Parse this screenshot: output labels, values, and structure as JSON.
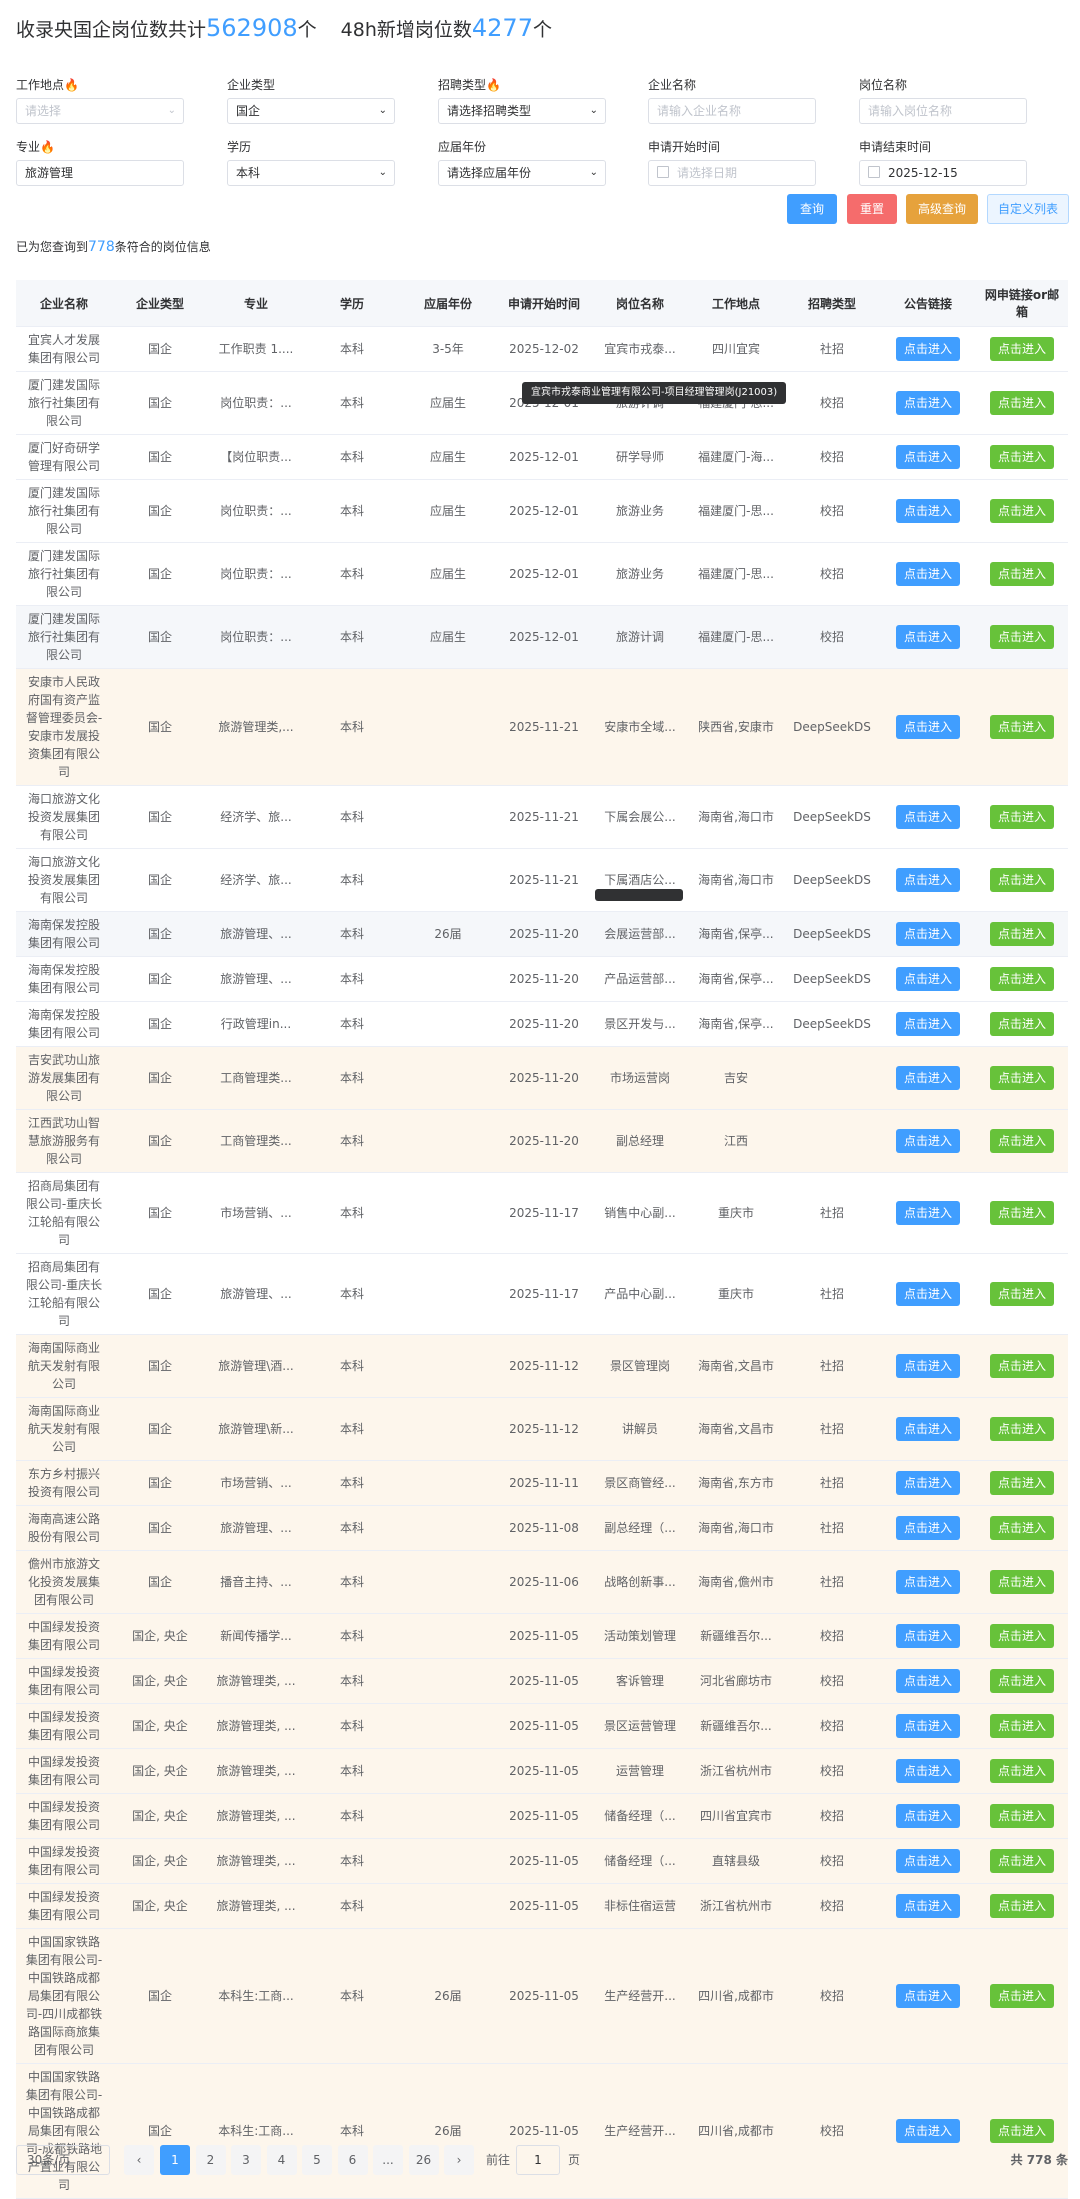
{
  "header": {
    "prefix": "收录央国企岗位数共计",
    "total_count": "562908",
    "unit1": "个",
    "new_label": "48h新增岗位数",
    "new_count": "4277",
    "unit2": "个"
  },
  "filters": {
    "work_location": {
      "label": "工作地点",
      "placeholder": "请选择"
    },
    "company_type": {
      "label": "企业类型",
      "value": "国企"
    },
    "recruit_type": {
      "label": "招聘类型",
      "value": "请选择招聘类型"
    },
    "company_name": {
      "label": "企业名称",
      "placeholder": "请输入企业名称"
    },
    "job_name": {
      "label": "岗位名称",
      "placeholder": "请输入岗位名称"
    },
    "major": {
      "label": "专业",
      "value": "旅游管理"
    },
    "education": {
      "label": "学历",
      "value": "本科"
    },
    "grad_year": {
      "label": "应届年份",
      "value": "请选择应届年份"
    },
    "start_date": {
      "label": "申请开始时间",
      "placeholder": "请选择日期"
    },
    "end_date": {
      "label": "申请结束时间",
      "value": "2025-12-15"
    },
    "fire_icon": "🔥"
  },
  "buttons": {
    "query": "查询",
    "reset": "重置",
    "advanced": "高级查询",
    "custom_list": "自定义列表"
  },
  "result": {
    "prefix": "已为您查询到",
    "count": "778",
    "suffix": "条符合的岗位信息"
  },
  "table": {
    "columns": [
      "企业名称",
      "企业类型",
      "专业",
      "学历",
      "应届年份",
      "申请开始时间",
      "岗位名称",
      "工作地点",
      "招聘类型",
      "公告链接",
      "网申链接or邮箱"
    ],
    "link_label": "点击进入",
    "rows": [
      {
        "company": "宜宾人才发展集团有限公司",
        "type": "国企",
        "major": "工作职责 1....",
        "edu": "本科",
        "year": "3-5年",
        "date": "2025-12-02",
        "job": "宜宾市戎泰...",
        "loc": "四川宜宾",
        "recruit": "社招",
        "bg": "w"
      },
      {
        "company": "厦门建发国际旅行社集团有限公司",
        "type": "国企",
        "major": "岗位职责：...",
        "edu": "本科",
        "year": "应届生",
        "date": "2025-12-01",
        "job": "旅游计调",
        "loc": "福建厦门-思...",
        "recruit": "校招",
        "bg": "w"
      },
      {
        "company": "厦门好奇研学管理有限公司",
        "type": "国企",
        "major": "【岗位职责...",
        "edu": "本科",
        "year": "应届生",
        "date": "2025-12-01",
        "job": "研学导师",
        "loc": "福建厦门-海...",
        "recruit": "校招",
        "bg": "w"
      },
      {
        "company": "厦门建发国际旅行社集团有限公司",
        "type": "国企",
        "major": "岗位职责：...",
        "edu": "本科",
        "year": "应届生",
        "date": "2025-12-01",
        "job": "旅游业务",
        "loc": "福建厦门-思...",
        "recruit": "校招",
        "bg": "w"
      },
      {
        "company": "厦门建发国际旅行社集团有限公司",
        "type": "国企",
        "major": "岗位职责：...",
        "edu": "本科",
        "year": "应届生",
        "date": "2025-12-01",
        "job": "旅游业务",
        "loc": "福建厦门-思...",
        "recruit": "校招",
        "bg": "w"
      },
      {
        "company": "厦门建发国际旅行社集团有限公司",
        "type": "国企",
        "major": "岗位职责：...",
        "edu": "本科",
        "year": "应届生",
        "date": "2025-12-01",
        "job": "旅游计调",
        "loc": "福建厦门-思...",
        "recruit": "校招",
        "bg": "g"
      },
      {
        "company": "安康市人民政府国有资产监督管理委员会-安康市发展投资集团有限公司",
        "type": "国企",
        "major": "旅游管理类,...",
        "edu": "本科",
        "year": "",
        "date": "2025-11-21",
        "job": "安康市全域...",
        "loc": "陕西省,安康市",
        "recruit": "DeepSeekDS",
        "bg": "o"
      },
      {
        "company": "海口旅游文化投资发展集团有限公司",
        "type": "国企",
        "major": "经济学、旅...",
        "edu": "本科",
        "year": "",
        "date": "2025-11-21",
        "job": "下属会展公...",
        "loc": "海南省,海口市",
        "recruit": "DeepSeekDS",
        "bg": "w"
      },
      {
        "company": "海口旅游文化投资发展集团有限公司",
        "type": "国企",
        "major": "经济学、旅...",
        "edu": "本科",
        "year": "",
        "date": "2025-11-21",
        "job": "下属酒店公...",
        "loc": "海南省,海口市",
        "recruit": "DeepSeekDS",
        "bg": "w"
      },
      {
        "company": "海南保发控股集团有限公司",
        "type": "国企",
        "major": "旅游管理、...",
        "edu": "本科",
        "year": "26届",
        "date": "2025-11-20",
        "job": "会展运营部...",
        "loc": "海南省,保亭...",
        "recruit": "DeepSeekDS",
        "bg": "g"
      },
      {
        "company": "海南保发控股集团有限公司",
        "type": "国企",
        "major": "旅游管理、...",
        "edu": "本科",
        "year": "",
        "date": "2025-11-20",
        "job": "产品运营部...",
        "loc": "海南省,保亭...",
        "recruit": "DeepSeekDS",
        "bg": "w"
      },
      {
        "company": "海南保发控股集团有限公司",
        "type": "国企",
        "major": "行政管理in...",
        "edu": "本科",
        "year": "",
        "date": "2025-11-20",
        "job": "景区开发与...",
        "loc": "海南省,保亭...",
        "recruit": "DeepSeekDS",
        "bg": "w"
      },
      {
        "company": "吉安武功山旅游发展集团有限公司",
        "type": "国企",
        "major": "工商管理类...",
        "edu": "本科",
        "year": "",
        "date": "2025-11-20",
        "job": "市场运营岗",
        "loc": "吉安",
        "recruit": "",
        "bg": "o"
      },
      {
        "company": "江西武功山智慧旅游服务有限公司",
        "type": "国企",
        "major": "工商管理类...",
        "edu": "本科",
        "year": "",
        "date": "2025-11-20",
        "job": "副总经理",
        "loc": "江西",
        "recruit": "",
        "bg": "o"
      },
      {
        "company": "招商局集团有限公司-重庆长江轮船有限公司",
        "type": "国企",
        "major": "市场营销、...",
        "edu": "本科",
        "year": "",
        "date": "2025-11-17",
        "job": "销售中心副...",
        "loc": "重庆市",
        "recruit": "社招",
        "bg": "w"
      },
      {
        "company": "招商局集团有限公司-重庆长江轮船有限公司",
        "type": "国企",
        "major": "旅游管理、...",
        "edu": "本科",
        "year": "",
        "date": "2025-11-17",
        "job": "产品中心副...",
        "loc": "重庆市",
        "recruit": "社招",
        "bg": "w"
      },
      {
        "company": "海南国际商业航天发射有限公司",
        "type": "国企",
        "major": "旅游管理\\酒...",
        "edu": "本科",
        "year": "",
        "date": "2025-11-12",
        "job": "景区管理岗",
        "loc": "海南省,文昌市",
        "recruit": "社招",
        "bg": "o"
      },
      {
        "company": "海南国际商业航天发射有限公司",
        "type": "国企",
        "major": "旅游管理\\新...",
        "edu": "本科",
        "year": "",
        "date": "2025-11-12",
        "job": "讲解员",
        "loc": "海南省,文昌市",
        "recruit": "社招",
        "bg": "o"
      },
      {
        "company": "东方乡村振兴投资有限公司",
        "type": "国企",
        "major": "市场营销、...",
        "edu": "本科",
        "year": "",
        "date": "2025-11-11",
        "job": "景区商管经...",
        "loc": "海南省,东方市",
        "recruit": "社招",
        "bg": "o"
      },
      {
        "company": "海南高速公路股份有限公司",
        "type": "国企",
        "major": "旅游管理、...",
        "edu": "本科",
        "year": "",
        "date": "2025-11-08",
        "job": "副总经理（...",
        "loc": "海南省,海口市",
        "recruit": "社招",
        "bg": "o"
      },
      {
        "company": "儋州市旅游文化投资发展集团有限公司",
        "type": "国企",
        "major": "播音主持、...",
        "edu": "本科",
        "year": "",
        "date": "2025-11-06",
        "job": "战略创新事...",
        "loc": "海南省,儋州市",
        "recruit": "社招",
        "bg": "o"
      },
      {
        "company": "中国绿发投资集团有限公司",
        "type": "国企, 央企",
        "major": "新闻传播学...",
        "edu": "本科",
        "year": "",
        "date": "2025-11-05",
        "job": "活动策划管理",
        "loc": "新疆维吾尔...",
        "recruit": "校招",
        "bg": "o"
      },
      {
        "company": "中国绿发投资集团有限公司",
        "type": "国企, 央企",
        "major": "旅游管理类, ...",
        "edu": "本科",
        "year": "",
        "date": "2025-11-05",
        "job": "客诉管理",
        "loc": "河北省廊坊市",
        "recruit": "校招",
        "bg": "o"
      },
      {
        "company": "中国绿发投资集团有限公司",
        "type": "国企, 央企",
        "major": "旅游管理类, ...",
        "edu": "本科",
        "year": "",
        "date": "2025-11-05",
        "job": "景区运营管理",
        "loc": "新疆维吾尔...",
        "recruit": "校招",
        "bg": "o"
      },
      {
        "company": "中国绿发投资集团有限公司",
        "type": "国企, 央企",
        "major": "旅游管理类, ...",
        "edu": "本科",
        "year": "",
        "date": "2025-11-05",
        "job": "运营管理",
        "loc": "浙江省杭州市",
        "recruit": "校招",
        "bg": "o"
      },
      {
        "company": "中国绿发投资集团有限公司",
        "type": "国企, 央企",
        "major": "旅游管理类, ...",
        "edu": "本科",
        "year": "",
        "date": "2025-11-05",
        "job": "储备经理（...",
        "loc": "四川省宜宾市",
        "recruit": "校招",
        "bg": "o"
      },
      {
        "company": "中国绿发投资集团有限公司",
        "type": "国企, 央企",
        "major": "旅游管理类, ...",
        "edu": "本科",
        "year": "",
        "date": "2025-11-05",
        "job": "储备经理（...",
        "loc": "直辖县级",
        "recruit": "校招",
        "bg": "o"
      },
      {
        "company": "中国绿发投资集团有限公司",
        "type": "国企, 央企",
        "major": "旅游管理类, ...",
        "edu": "本科",
        "year": "",
        "date": "2025-11-05",
        "job": "非标住宿运营",
        "loc": "浙江省杭州市",
        "recruit": "校招",
        "bg": "o"
      },
      {
        "company": "中国国家铁路集团有限公司-中国铁路成都局集团有限公司-四川成都铁路国际商旅集团有限公司",
        "type": "国企",
        "major": "本科生:工商...",
        "edu": "本科",
        "year": "26届",
        "date": "2025-11-05",
        "job": "生产经营开...",
        "loc": "四川省,成都市",
        "recruit": "校招",
        "bg": "o"
      },
      {
        "company": "中国国家铁路集团有限公司-中国铁路成都局集团有限公司-成都铁路地产置业有限公司",
        "type": "国企",
        "major": "本科生:工商...",
        "edu": "本科",
        "year": "26届",
        "date": "2025-11-05",
        "job": "生产经营开...",
        "loc": "四川省,成都市",
        "recruit": "校招",
        "bg": "o"
      }
    ]
  },
  "tooltip": {
    "text": "宜宾市戎泰商业管理有限公司-项目经理管理岗(J21003)"
  },
  "pagination": {
    "page_size": "30条/页",
    "prev": "‹",
    "pages": [
      "1",
      "2",
      "3",
      "4",
      "5",
      "6",
      "...",
      "26"
    ],
    "next": "›",
    "goto_label": "前往",
    "goto_value": "1",
    "goto_suffix": "页",
    "total": "共 778 条"
  }
}
